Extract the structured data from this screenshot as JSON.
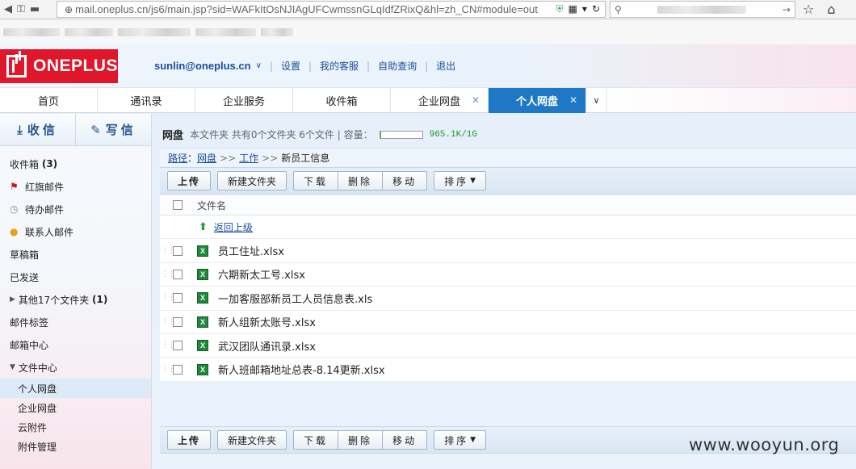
{
  "browser": {
    "url": "mail.oneplus.cn/js6/main.jsp?sid=WAFkItOsNJIAgUFCwmssnGLqIdfZRixQ&hl=zh_CN#module=out",
    "icons": [
      "key-icon",
      "folder-icon",
      "globe-icon",
      "shield-icon",
      "qr-icon",
      "dropdown-icon",
      "refresh-icon",
      "search-icon",
      "forward-icon",
      "star-icon",
      "home-icon"
    ]
  },
  "header": {
    "brand": "ONEPLUS",
    "user_email": "sunlin@oneplus.cn",
    "links": [
      "设置",
      "我的客服",
      "自助查询",
      "退出"
    ]
  },
  "tabs": [
    {
      "label": "首页",
      "closable": false,
      "active": false
    },
    {
      "label": "通讯录",
      "closable": false,
      "active": false
    },
    {
      "label": "企业服务",
      "closable": false,
      "active": false
    },
    {
      "label": "收件箱",
      "closable": false,
      "active": false
    },
    {
      "label": "企业网盘",
      "closable": true,
      "active": false
    },
    {
      "label": "个人网盘",
      "closable": true,
      "active": true
    }
  ],
  "sidebar": {
    "receive": "收信",
    "compose": "写信",
    "items": [
      {
        "label": "收件箱",
        "count": "(3)",
        "icon": ""
      },
      {
        "label": "红旗邮件",
        "count": "",
        "icon": "flag-icon"
      },
      {
        "label": "待办邮件",
        "count": "",
        "icon": "clock-icon"
      },
      {
        "label": "联系人邮件",
        "count": "",
        "icon": "person-icon"
      },
      {
        "label": "草稿箱",
        "count": "",
        "icon": ""
      },
      {
        "label": "已发送",
        "count": "",
        "icon": ""
      },
      {
        "label": "其他17个文件夹",
        "count": "(1)",
        "icon": "expand-icon"
      },
      {
        "label": "邮件标签",
        "count": "",
        "icon": ""
      },
      {
        "label": "邮箱中心",
        "count": "",
        "icon": ""
      },
      {
        "label": "文件中心",
        "count": "",
        "icon": "collapse-icon"
      }
    ],
    "sub_items": [
      {
        "label": "个人网盘",
        "active": true
      },
      {
        "label": "企业网盘",
        "active": false
      },
      {
        "label": "云附件",
        "active": false
      },
      {
        "label": "附件管理",
        "active": false
      }
    ]
  },
  "disk": {
    "title": "网盘",
    "summary": "本文件夹 共有0个文件夹 6个文件 | 容量：",
    "quota": "965.1K/1G",
    "quota_fraction": 0.001
  },
  "path": {
    "label": "路径",
    "crumbs": [
      "网盘",
      "工作"
    ],
    "current": "新员工信息"
  },
  "toolbar": {
    "upload": "上传",
    "new_folder": "新建文件夹",
    "download": "下载",
    "delete": "删除",
    "move": "移动",
    "sort": "排序"
  },
  "list": {
    "column_name": "文件名",
    "back_label": "返回上级",
    "files": [
      "员工住址.xlsx",
      "六期新太工号.xlsx",
      "一加客服部新员工人员信息表.xls",
      "新人组新太账号.xlsx",
      "武汉团队通讯录.xlsx",
      "新人班邮箱地址总表-8.14更新.xlsx"
    ]
  },
  "watermark": "www.wooyun.org"
}
